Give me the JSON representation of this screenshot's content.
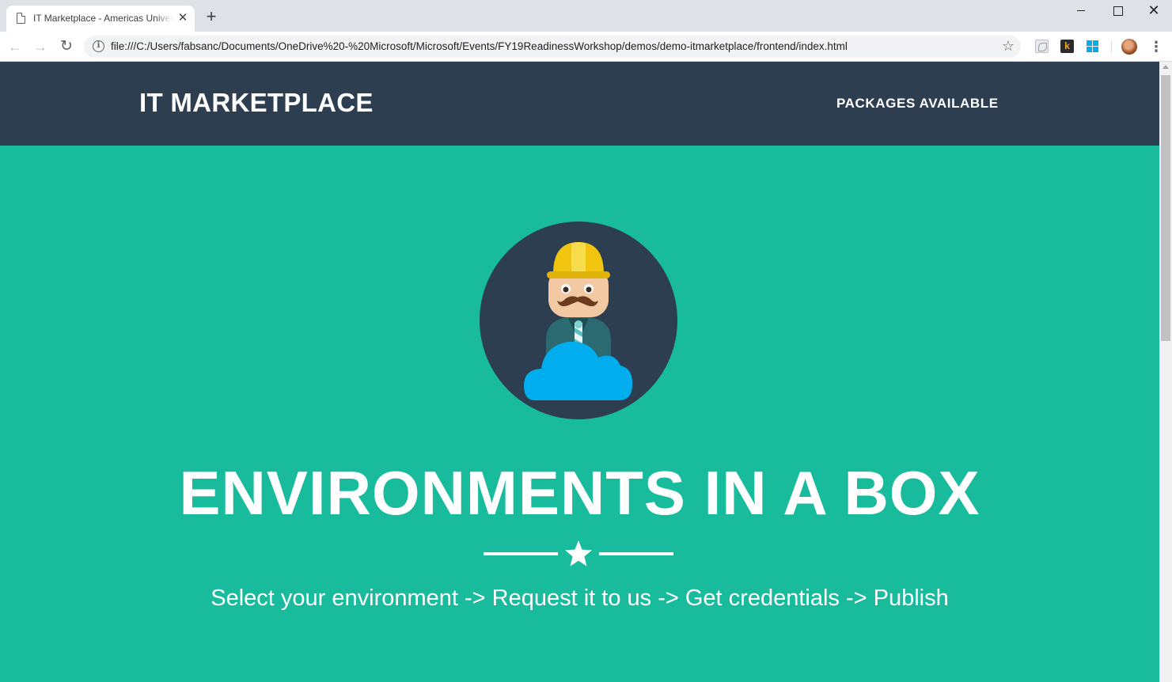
{
  "browser": {
    "tab_title": "IT Marketplace - Americas Universal",
    "tab_close": "✕",
    "new_tab": "+",
    "url": "file:///C:/Users/fabsanc/Documents/OneDrive%20-%20Microsoft/Microsoft/Events/FY19ReadinessWorkshop/demos/demo-itmarketplace/frontend/index.html",
    "window_close": "✕",
    "icons": [
      "back-arrow-icon",
      "forward-arrow-icon",
      "reload-icon",
      "info-icon",
      "bookmark-star-icon",
      "pdf-extension-icon",
      "k-extension-icon",
      "windows-extension-icon",
      "profile-avatar",
      "menu-icon"
    ]
  },
  "site": {
    "brand": "IT MARKETPLACE",
    "nav_link": "PACKAGES AVAILABLE",
    "heading": "ENVIRONMENTS IN A BOX",
    "subheading": "Select your environment -> Request it to us -> Get credentials -> Publish"
  },
  "colors": {
    "navbar": "#2c3e50",
    "hero_background": "#18bc9c",
    "cloud": "#00adef",
    "helmet": "#f1c40f"
  }
}
